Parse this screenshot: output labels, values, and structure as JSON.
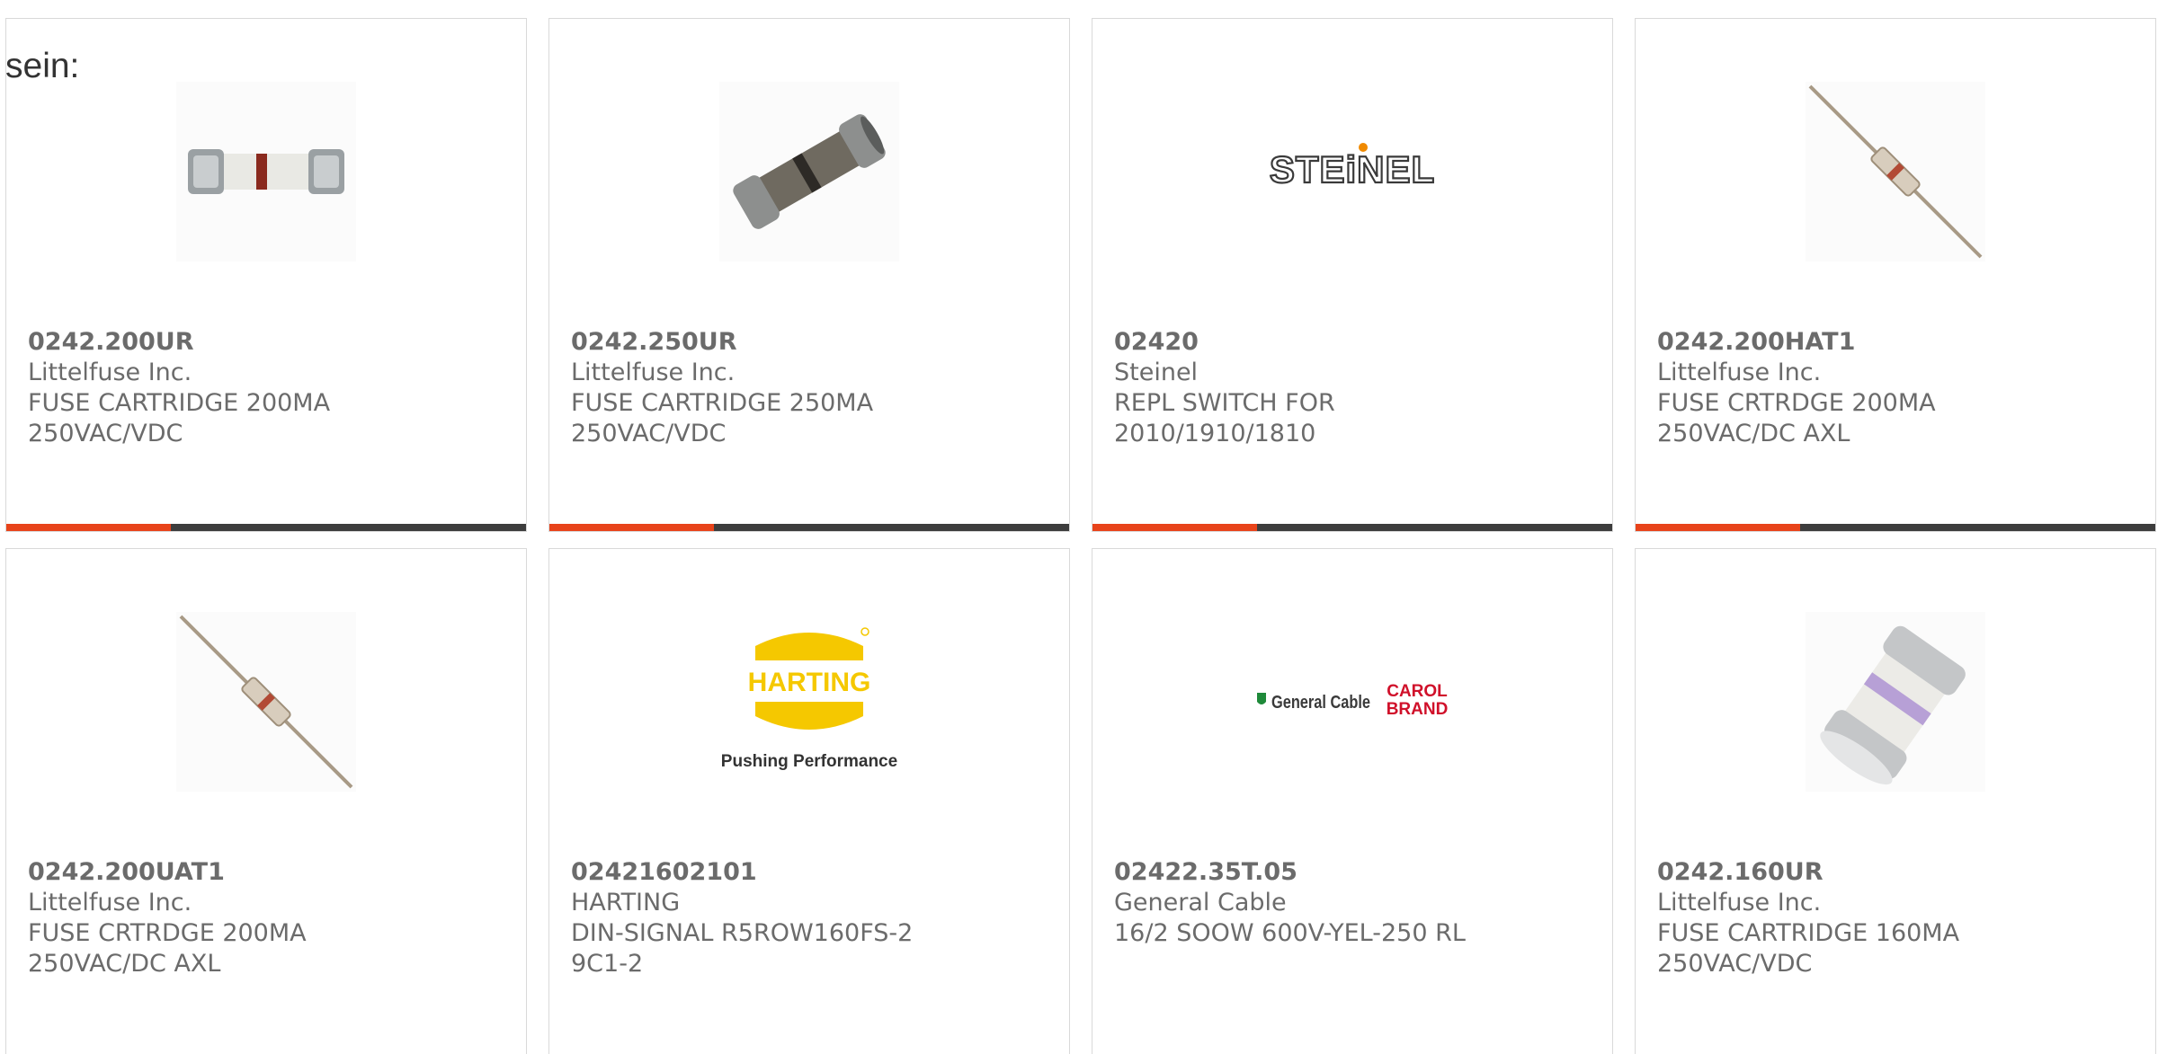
{
  "stray_text": "sein:",
  "colors": {
    "accent": "#e8431a",
    "bar": "#3d3d3d",
    "text": "#6b6b6b",
    "border": "#d9d9d9"
  },
  "products": [
    {
      "part_number": "0242.200UR",
      "manufacturer": "Littelfuse Inc.",
      "description_lines": [
        "FUSE CARTRIDGE 200MA",
        "250VAC/VDC"
      ],
      "image": "fuse-cartridge-red-band-image"
    },
    {
      "part_number": "0242.250UR",
      "manufacturer": "Littelfuse Inc.",
      "description_lines": [
        "FUSE CARTRIDGE 250MA",
        "250VAC/VDC"
      ],
      "image": "fuse-cartridge-dark-image"
    },
    {
      "part_number": "02420",
      "manufacturer": "Steinel",
      "description_lines": [
        "REPL SWITCH FOR",
        "2010/1910/1810"
      ],
      "image": "steinel-logo",
      "logo_text": "STEiNEL"
    },
    {
      "part_number": "0242.200HAT1",
      "manufacturer": "Littelfuse Inc.",
      "description_lines": [
        "FUSE CRTRDGE 200MA",
        "250VAC/DC AXL"
      ],
      "image": "axial-fuse-image"
    },
    {
      "part_number": "0242.200UAT1",
      "manufacturer": "Littelfuse Inc.",
      "description_lines": [
        "FUSE CRTRDGE 200MA",
        "250VAC/DC AXL"
      ],
      "image": "axial-fuse-image"
    },
    {
      "part_number": "02421602101",
      "manufacturer": "HARTING",
      "description_lines": [
        "DIN-SIGNAL R5ROW160FS-2",
        "9C1-2"
      ],
      "image": "harting-logo",
      "logo_text": "HARTING",
      "logo_tagline": "Pushing Performance"
    },
    {
      "part_number": "02422.35T.05",
      "manufacturer": "General Cable",
      "description_lines": [
        "16/2 SOOW 600V-YEL-250 RL",
        ""
      ],
      "image": "general-cable-logo",
      "logo_text": "General Cable",
      "logo_brand_top": "CAROL",
      "logo_brand_bottom": "BRAND"
    },
    {
      "part_number": "0242.160UR",
      "manufacturer": "Littelfuse Inc.",
      "description_lines": [
        "FUSE CARTRIDGE 160MA",
        "250VAC/VDC"
      ],
      "image": "fuse-cartridge-purple-band-image"
    }
  ]
}
